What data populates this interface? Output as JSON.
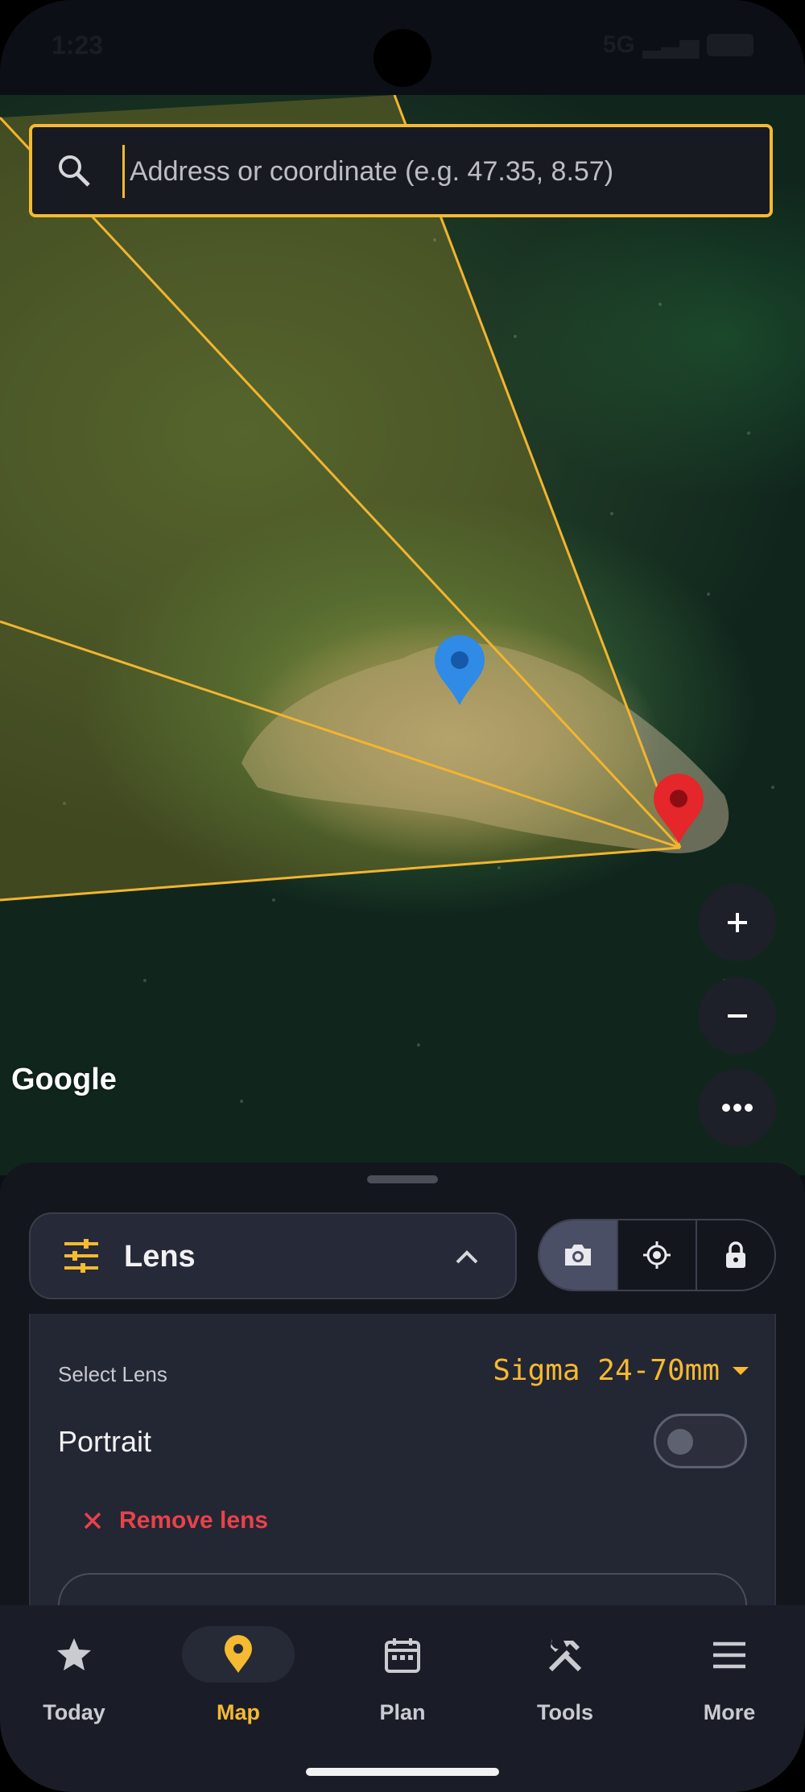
{
  "status_bar": {
    "time": "1:23",
    "network": "5G"
  },
  "map": {
    "attribution": "Google"
  },
  "search": {
    "placeholder": "Address or coordinate (e.g. 47.35, 8.57)"
  },
  "map_controls": {
    "zoom_in": "+",
    "zoom_out": "−"
  },
  "sheet": {
    "dropdown_title": "Lens",
    "modes": [
      "camera-icon",
      "target-icon",
      "lock-icon"
    ],
    "select_lens_label": "Select Lens",
    "selected_lens": "Sigma 24-70mm",
    "portrait_label": "Portrait",
    "portrait_enabled": false,
    "remove_lens_label": "Remove lens"
  },
  "nav": {
    "items": [
      {
        "label": "Today",
        "icon": "star-icon"
      },
      {
        "label": "Map",
        "icon": "map-pin-icon",
        "active": true
      },
      {
        "label": "Plan",
        "icon": "calendar-icon"
      },
      {
        "label": "Tools",
        "icon": "tools-icon"
      },
      {
        "label": "More",
        "icon": "menu-icon"
      }
    ]
  },
  "colors": {
    "accent": "#f5b932",
    "danger": "#e8424a",
    "pin_blue": "#2f8be6",
    "pin_red": "#e5262a"
  }
}
